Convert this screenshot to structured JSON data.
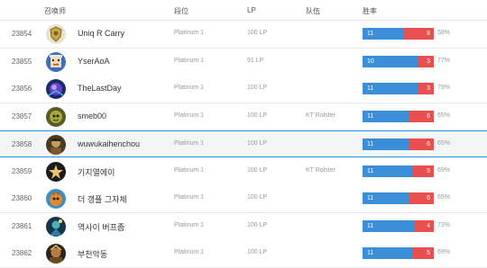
{
  "header": {
    "summoner": "召唤师",
    "tier": "段位",
    "lp": "LP",
    "team": "队伍",
    "winrate": "胜率"
  },
  "rows": [
    {
      "rank": "23854",
      "name": "Uniq R Carry",
      "tier": "Platinum 1",
      "lp": "100 LP",
      "team": "",
      "wins": "11",
      "losses": "8",
      "winrate": "58%",
      "win_fraction": 0.58,
      "avatar": "shield-crest-icon",
      "highlight": false
    },
    {
      "rank": "23855",
      "name": "YserAoA",
      "tier": "Platinum 1",
      "lp": "91 LP",
      "team": "",
      "wins": "10",
      "losses": "3",
      "winrate": "77%",
      "win_fraction": 0.77,
      "avatar": "pixel-face-icon",
      "highlight": false
    },
    {
      "rank": "23856",
      "name": "TheLastDay",
      "tier": "Platinum 1",
      "lp": "100 LP",
      "team": "",
      "wins": "11",
      "losses": "3",
      "winrate": "79%",
      "win_fraction": 0.79,
      "avatar": "purple-orb-icon",
      "highlight": false
    },
    {
      "rank": "23857",
      "name": "smeb00",
      "tier": "Platinum 1",
      "lp": "100 LP",
      "team": "KT Rolster",
      "wins": "11",
      "losses": "6",
      "winrate": "65%",
      "win_fraction": 0.65,
      "avatar": "green-creature-icon",
      "highlight": false
    },
    {
      "rank": "23858",
      "name": "wuwukaihenchou",
      "tier": "Platinum 1",
      "lp": "100 LP",
      "team": "",
      "wins": "11",
      "losses": "6",
      "winrate": "65%",
      "win_fraction": 0.65,
      "avatar": "warrior-portrait-icon",
      "highlight": true
    },
    {
      "rank": "23859",
      "name": "기지열에이",
      "tier": "Platinum 1",
      "lp": "100 LP",
      "team": "KT Rolster",
      "wins": "11",
      "losses": "5",
      "winrate": "69%",
      "win_fraction": 0.69,
      "avatar": "star-dark-icon",
      "highlight": false
    },
    {
      "rank": "23860",
      "name": "더 갱플 그자체",
      "tier": "Platinum 1",
      "lp": "100 LP",
      "team": "",
      "wins": "11",
      "losses": "6",
      "winrate": "65%",
      "win_fraction": 0.65,
      "avatar": "orange-creature-icon",
      "highlight": false
    },
    {
      "rank": "23861",
      "name": "역사이 버프좀",
      "tier": "Platinum 1",
      "lp": "100 LP",
      "team": "",
      "wins": "11",
      "losses": "4",
      "winrate": "73%",
      "win_fraction": 0.73,
      "avatar": "teal-figure-icon",
      "highlight": false
    },
    {
      "rank": "23862",
      "name": "부천악동",
      "tier": "Platinum 1",
      "lp": "100 LP",
      "team": "",
      "wins": "11",
      "losses": "5",
      "winrate": "69%",
      "win_fraction": 0.69,
      "avatar": "brown-warrior-icon",
      "highlight": false
    }
  ],
  "colors": {
    "win_bar": "#3b8fd8",
    "loss_bar": "#e84f4f",
    "highlight_border": "#3a8fd4"
  }
}
